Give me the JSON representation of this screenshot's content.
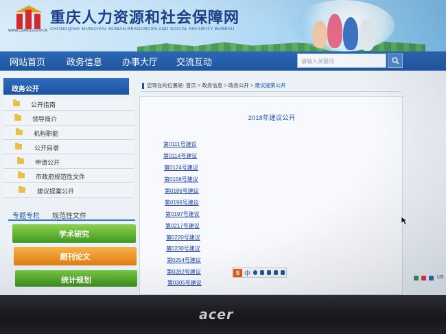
{
  "site": {
    "title": "重庆人力资源和社会保障网",
    "subtitle": "CHONGQING MUNICIPAL HUMAN RESOURCES AND SOCIAL SECURITY BUREAU",
    "url": "WWW.CQHRSS.GOV.CN"
  },
  "nav": {
    "items": [
      "网站首页",
      "政务信息",
      "办事大厅",
      "交流互动"
    ],
    "search_placeholder": "请输入关键词"
  },
  "sidebar": {
    "header": "政务公开",
    "items": [
      "公开指南",
      "领导简介",
      "机构职能",
      "公开目录",
      "申请公开",
      "市政府规范性文件",
      "建议提案公开"
    ]
  },
  "tabs": [
    "专题专栏",
    "规范性文件"
  ],
  "promos": [
    "学术研究",
    "期刊论文",
    "统计规划"
  ],
  "breadcrumb": {
    "prefix": "您现在的位置是:",
    "path": "首页 > 政务信息 > 政务公开 > ",
    "current": "建议提案公开"
  },
  "content": {
    "heading": "2018年建议公开",
    "links": [
      "第0111号建议",
      "第0114号建议",
      "第0124号建议",
      "第0156号建议",
      "第0186号建议",
      "第0196号建议",
      "第0197号建议",
      "第0217号建议",
      "第0220号建议",
      "第0230号建议",
      "第0254号建议",
      "第0282号建议",
      "第0305号建议"
    ]
  },
  "ime": {
    "label": "中"
  },
  "tray": {
    "lang": "US"
  },
  "monitor": {
    "brand": "acer"
  },
  "colors": {
    "nav": "#1f55a0",
    "link": "#1b3fae",
    "accent_green": "#4fa64a",
    "accent_orange": "#e07d12"
  }
}
